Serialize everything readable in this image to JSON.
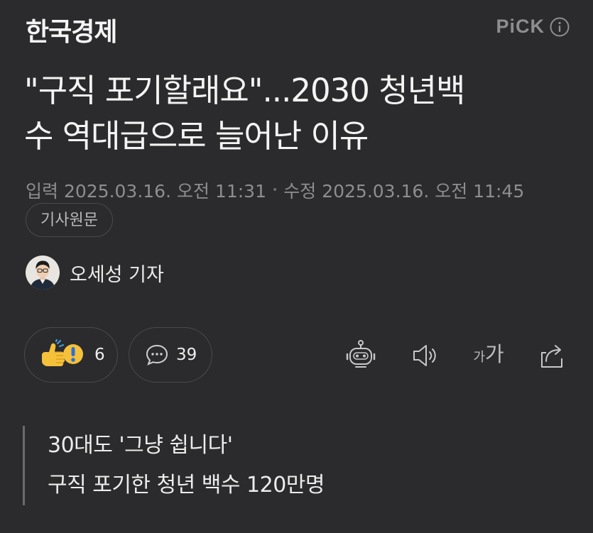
{
  "header": {
    "publisher": "한국경제",
    "pick_label": "PiCK"
  },
  "article": {
    "title_line1": "\"구직 포기할래요\"...2030 청년백",
    "title_line2": "수 역대급으로 늘어난 이유",
    "published": "입력 2025.03.16. 오전 11:31",
    "modified": "수정 2025.03.16. 오전 11:45",
    "original_button": "기사원문",
    "author": "오세성 기자"
  },
  "actions": {
    "reaction_count": "6",
    "comment_count": "39",
    "font_size_small": "가",
    "font_size_big": "가"
  },
  "summary": {
    "lines": [
      "30대도 '그냥 쉽니다'",
      "구직 포기한 청년 백수 120만명"
    ]
  },
  "colors": {
    "background": "#2b2b2d",
    "muted_text": "#8d8d92",
    "border": "#4a4a4e"
  },
  "icons": {
    "info": "info-circle-icon",
    "avatar": "author-avatar",
    "reaction": "thumbs-up-emoji-icon",
    "comment": "speech-bubble-icon",
    "robot": "robot-summary-icon",
    "speaker": "speaker-icon",
    "share": "share-icon"
  }
}
